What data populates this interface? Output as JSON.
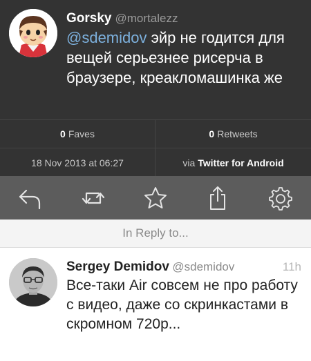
{
  "tweet": {
    "author_name": "Gorsky",
    "author_handle": "@mortalezz",
    "mention": "@sdemidov",
    "body": " эйр не годится для вещей серьезнее рисерча в браузере, креакломашинка же"
  },
  "stats": {
    "faves_count": "0",
    "faves_label": "Faves",
    "retweets_count": "0",
    "retweets_label": "Retweets",
    "timestamp": "18 Nov 2013 at 06:27",
    "via_prefix": "via",
    "client": "Twitter for Android"
  },
  "toolbar": {
    "icons": [
      "reply-icon",
      "retweet-icon",
      "favorite-icon",
      "share-icon",
      "settings-icon"
    ]
  },
  "reply_header": "In Reply to...",
  "reply": {
    "author_name": "Sergey Demidov",
    "author_handle": "@sdemidov",
    "time": "11h",
    "body": "Все-таки Air совсем не про работу с видео, даже со скринкастами в скромном 720p..."
  },
  "colors": {
    "dark_bg": "#333333",
    "toolbar_bg": "#5c5c5c",
    "mention": "#7db1de"
  }
}
